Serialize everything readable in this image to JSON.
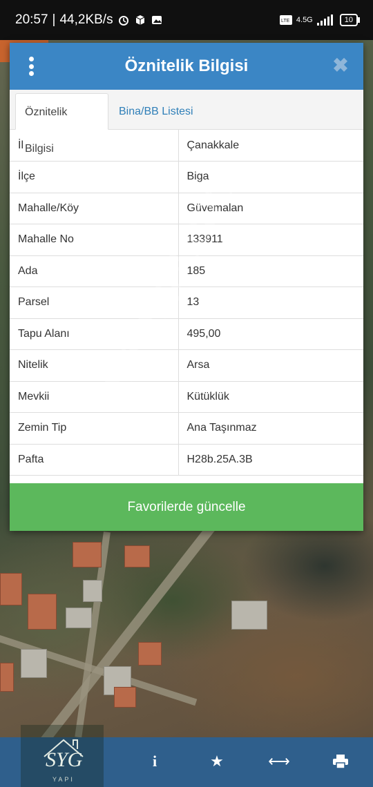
{
  "status_bar": {
    "time": "20:57",
    "network_speed": "44,2KB/s",
    "network_type": "4.5G",
    "battery": "10",
    "icons": [
      "alarm-icon",
      "box-icon",
      "gallery-icon",
      "volte-icon",
      "signal-icon",
      "battery-icon"
    ]
  },
  "modal": {
    "title": "Öznitelik Bilgisi",
    "close_glyph": "✖",
    "tabs": [
      {
        "label": "Öznitelik Bilgisi",
        "active": true
      },
      {
        "label": "Bina/BB Listesi",
        "active": false
      }
    ],
    "rows": [
      {
        "key": "İl",
        "value": "Çanakkale"
      },
      {
        "key": "İlçe",
        "value": "Biga"
      },
      {
        "key": "Mahalle/Köy",
        "value": "Güvemalan"
      },
      {
        "key": "Mahalle No",
        "value": "133911"
      },
      {
        "key": "Ada",
        "value": "185"
      },
      {
        "key": "Parsel",
        "value": "13"
      },
      {
        "key": "Tapu Alanı",
        "value": "495,00"
      },
      {
        "key": "Nitelik",
        "value": "Arsa"
      },
      {
        "key": "Mevkii",
        "value": "Kütüklük"
      },
      {
        "key": "Zemin Tip",
        "value": "Ana Taşınmaz"
      },
      {
        "key": "Pafta",
        "value": "H28b.25A.3B"
      }
    ],
    "favorite_button": "Favorilerde güncelle"
  },
  "watermark": "emlakjet.com",
  "bottom_bar": {
    "logo_text": "SYG",
    "logo_subtext": "YAPI",
    "icons": [
      "info-icon",
      "star-icon",
      "measure-icon",
      "print-icon"
    ]
  },
  "colors": {
    "header": "#3b86c5",
    "tab_link": "#2f7fb8",
    "favorite_button": "#5cb85c",
    "bottom_bar": "#2f5f8c"
  }
}
